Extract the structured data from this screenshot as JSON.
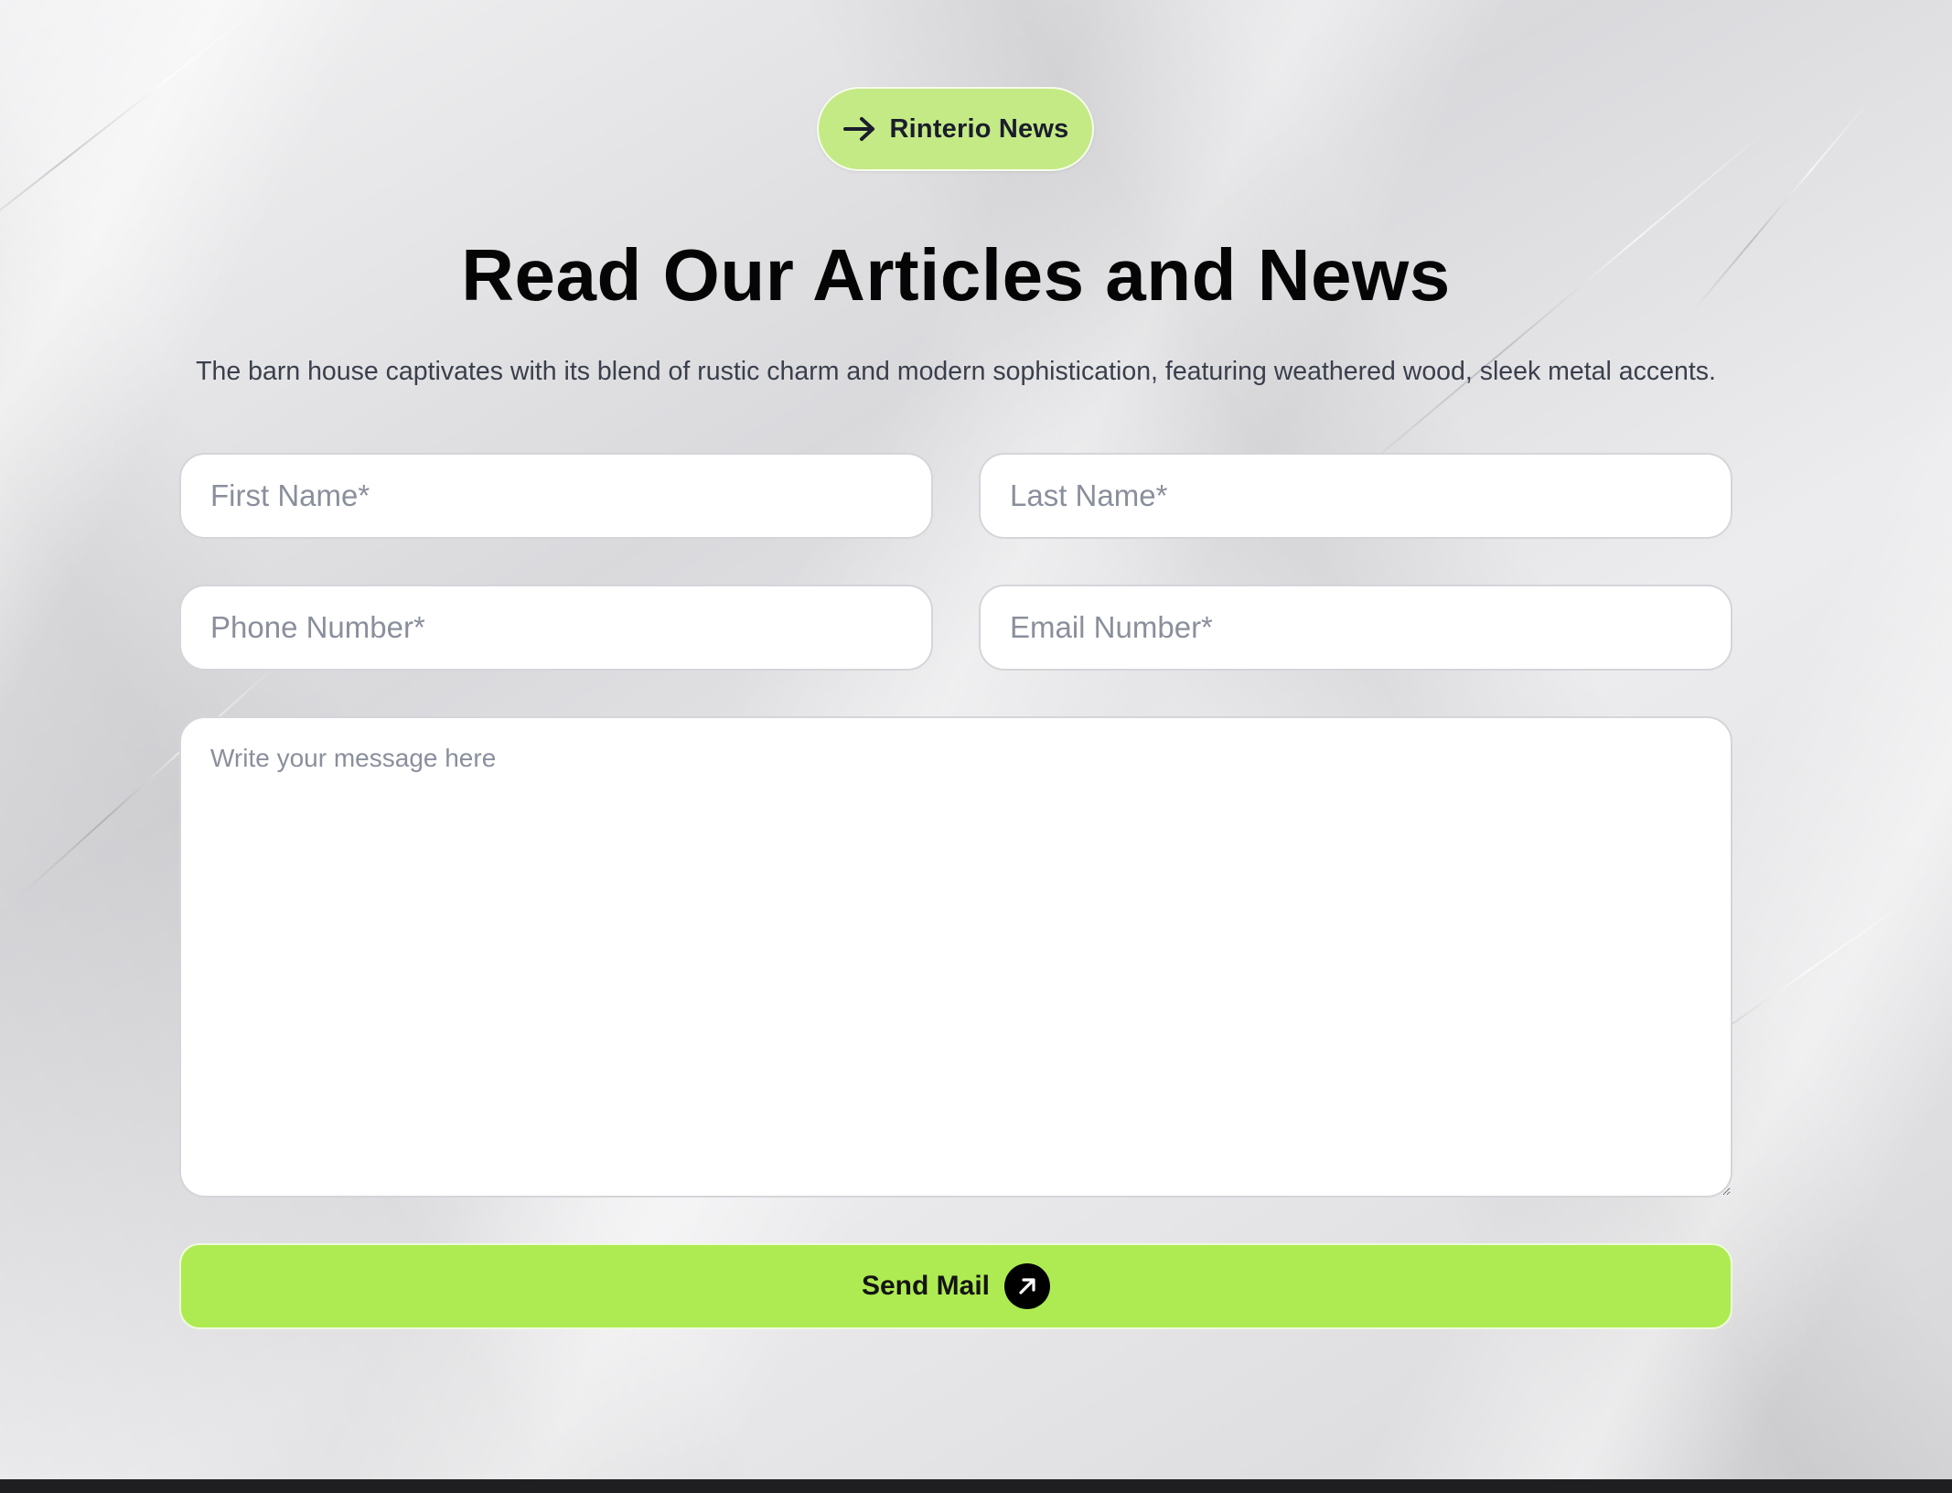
{
  "colors": {
    "badge_bg": "#c4ea86",
    "button_bg": "#aeeb53",
    "title_text": "#050505",
    "footer_bg": "#1f1f21"
  },
  "badge": {
    "label": "Rinterio News",
    "icon": "arrow-right-icon"
  },
  "heading": {
    "title": "Read Our Articles and News",
    "subtitle": "The barn house captivates with its blend of rustic charm and modern sophistication, featuring weathered wood, sleek metal accents."
  },
  "form": {
    "first_name": {
      "placeholder": "First Name*",
      "value": ""
    },
    "last_name": {
      "placeholder": "Last Name*",
      "value": ""
    },
    "phone": {
      "placeholder": "Phone Number*",
      "value": ""
    },
    "email": {
      "placeholder": "Email Number*",
      "value": ""
    },
    "message": {
      "placeholder": "Write your message here",
      "value": ""
    },
    "submit": {
      "label": "Send Mail",
      "icon": "arrow-up-right-icon"
    }
  }
}
